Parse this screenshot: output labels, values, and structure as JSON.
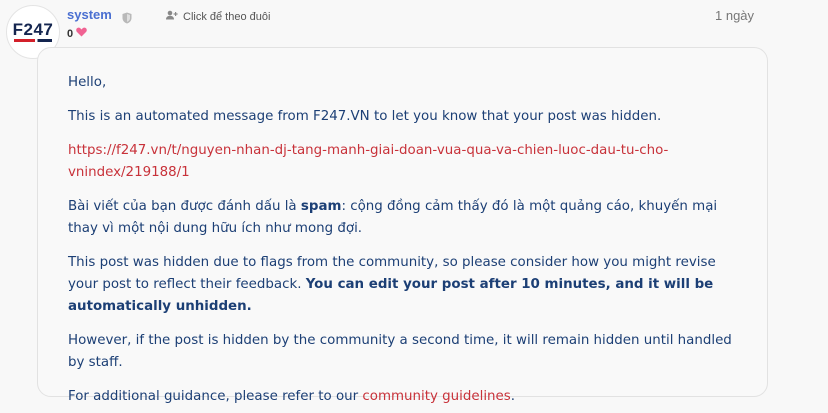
{
  "post": {
    "logo_text": "F247",
    "username": "system",
    "follow_label": "Click để theo đuôi",
    "time": "1 ngày",
    "likes": "0"
  },
  "message": {
    "greeting": "Hello,",
    "intro": "This is an automated message from F247.VN to let you know that your post was hidden.",
    "link_line1": "https://f247.vn/t/nguyen-nhan-dj-tang-manh-giai-doan-vua-qua-va-chien-luoc-dau-tu-cho-",
    "link_line2": "vnindex/219188/1",
    "vn_part1": "Bài viết của bạn được đánh dấu là ",
    "vn_bold": "spam",
    "vn_part2": ": cộng đồng cảm thấy đó là một quảng cáo, khuyến mại thay vì một nội dung hữu ích như mong đợi.",
    "flags_part1": "This post was hidden due to flags from the community, so please consider how you might revise your post to reflect their feedback. ",
    "flags_bold": "You can edit your post after 10 minutes, and it will be automatically unhidden.",
    "second_time": "However, if the post is hidden by the community a second time, it will remain hidden until handled by staff.",
    "guidance_prefix": "For additional guidance, please refer to our ",
    "guidance_link": "community guidelines",
    "guidance_suffix": "."
  },
  "colors": {
    "username": "#4a6fd1",
    "text": "#1c3f75",
    "link": "#c8323a",
    "heart": "#f06292"
  },
  "icons": [
    "shield-icon",
    "add-user-icon",
    "heart-icon"
  ]
}
